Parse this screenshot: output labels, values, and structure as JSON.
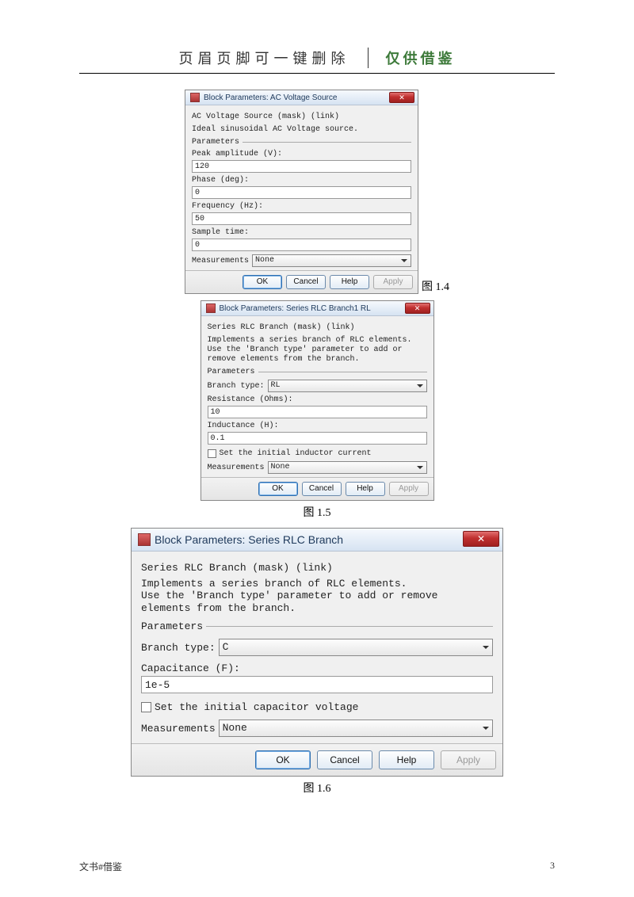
{
  "header": {
    "left": "页眉页脚可一键删除",
    "right": "仅供借鉴"
  },
  "figcap": {
    "d1": "图 1.4",
    "d2": "图 1.5",
    "d3": "图 1.6"
  },
  "d1": {
    "title": "Block Parameters: AC Voltage Source",
    "mask": "AC Voltage Source (mask) (link)",
    "desc": "Ideal sinusoidal AC Voltage source.",
    "section": "Parameters",
    "peak_lbl": "Peak amplitude (V):",
    "peak_val": "120",
    "phase_lbl": "Phase (deg):",
    "phase_val": "0",
    "freq_lbl": "Frequency (Hz):",
    "freq_val": "50",
    "sample_lbl": "Sample time:",
    "sample_val": "0",
    "meas_lbl": "Measurements",
    "meas_val": "None"
  },
  "d2": {
    "title": "Block Parameters: Series RLC Branch1 RL",
    "mask": "Series RLC Branch (mask) (link)",
    "desc": "Implements a series branch of RLC elements.\nUse the 'Branch type' parameter to add or remove elements from the branch.",
    "section": "Parameters",
    "btype_lbl": "Branch type:",
    "btype_val": "RL",
    "res_lbl": "Resistance (Ohms):",
    "res_val": "10",
    "ind_lbl": "Inductance (H):",
    "ind_val": "0.1",
    "chk_lbl": "Set the initial inductor current",
    "meas_lbl": "Measurements",
    "meas_val": "None"
  },
  "d3": {
    "title": "Block Parameters: Series RLC Branch",
    "mask": "Series RLC Branch (mask) (link)",
    "desc": "Implements a series branch of RLC elements.\nUse the 'Branch type' parameter to add or remove elements from the branch.",
    "section": "Parameters",
    "btype_lbl": "Branch type:",
    "btype_val": "C",
    "cap_lbl": "Capacitance (F):",
    "cap_val": "1e-5",
    "chk_lbl": "Set the initial capacitor voltage",
    "meas_lbl": "Measurements",
    "meas_val": "None"
  },
  "buttons": {
    "ok": "OK",
    "cancel": "Cancel",
    "help": "Help",
    "apply": "Apply"
  },
  "footer": {
    "left": "文书#借鉴",
    "right": "3"
  }
}
